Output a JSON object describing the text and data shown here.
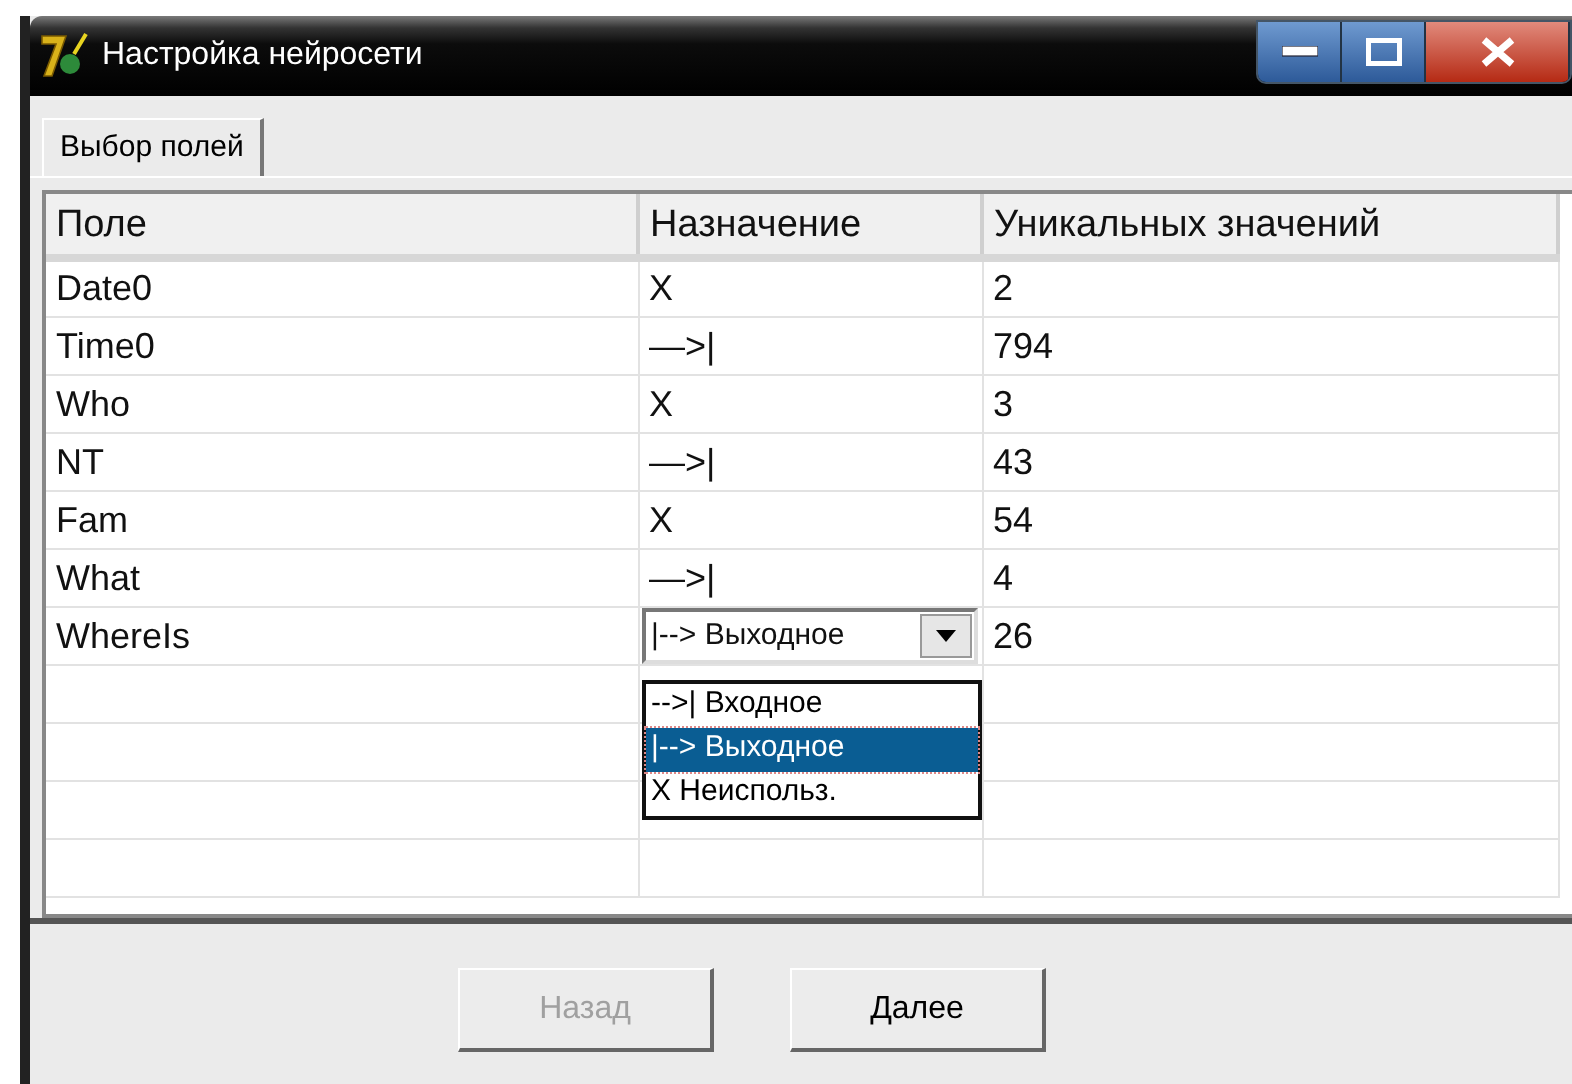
{
  "window": {
    "title": "Настройка нейросети"
  },
  "tabs": [
    {
      "label": "Выбор полей",
      "selected": true
    }
  ],
  "table": {
    "columns": [
      "Поле",
      "Назначение",
      "Уникальных значений"
    ],
    "rows": [
      {
        "field": "Date0",
        "role": "X",
        "unique": "2"
      },
      {
        "field": "Time0",
        "role": "—>|",
        "unique": "794"
      },
      {
        "field": "Who",
        "role": "X",
        "unique": "3"
      },
      {
        "field": "NT",
        "role": "—>|",
        "unique": "43"
      },
      {
        "field": "Fam",
        "role": "X",
        "unique": "54"
      },
      {
        "field": "What",
        "role": "—>|",
        "unique": "4"
      },
      {
        "field": "WhereIs",
        "kind": "dropdown",
        "role": "|--> Выходное",
        "unique": "26",
        "expanded": true,
        "options": [
          {
            "label": "-->| Входное",
            "selected": false
          },
          {
            "label": "|--> Выходное",
            "selected": true
          },
          {
            "label": "X Неиспольз.",
            "selected": false
          }
        ]
      }
    ]
  },
  "buttons": [
    {
      "label": "Назад",
      "disabled": true
    },
    {
      "label": "Далее",
      "disabled": false
    }
  ]
}
